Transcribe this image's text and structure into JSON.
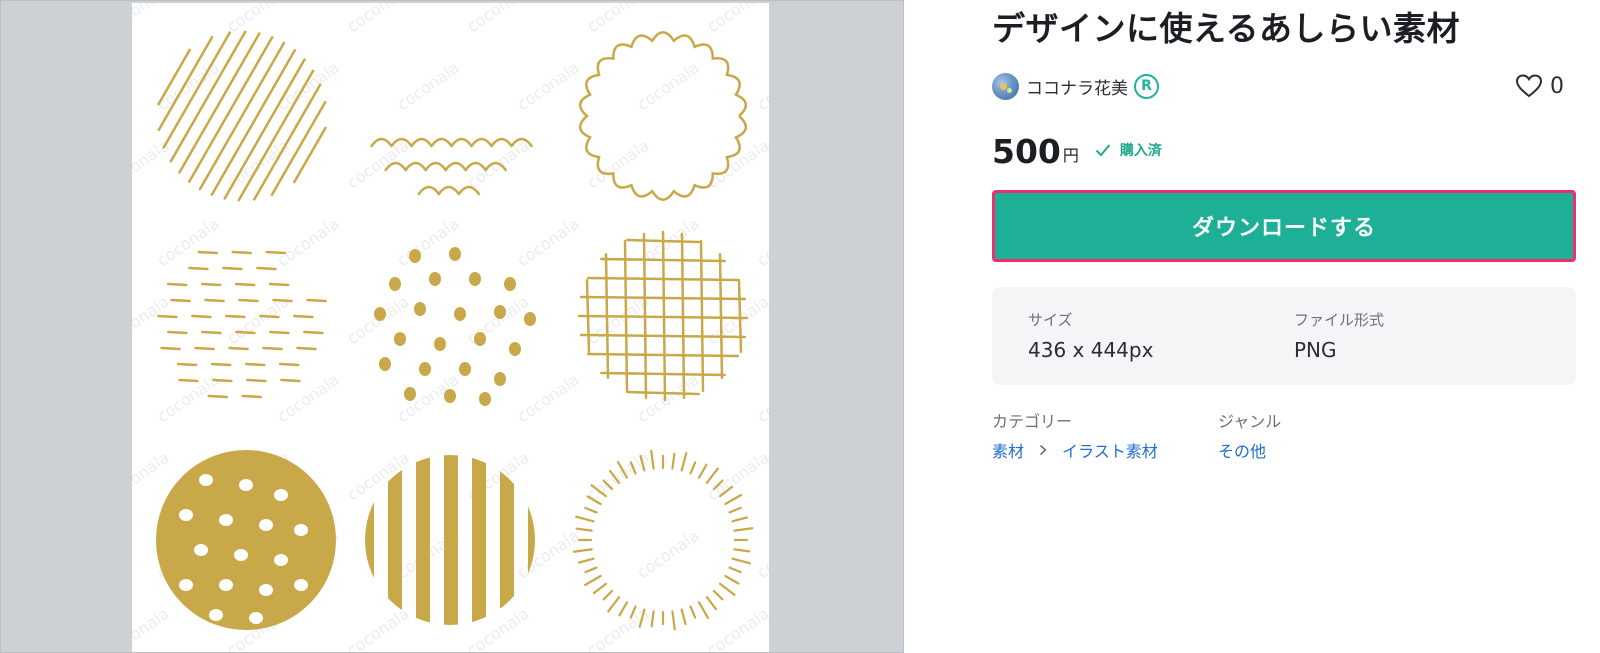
{
  "product": {
    "title": "デザインに使えるあしらい素材",
    "author": "ココナラ花美",
    "rank_badge": "R",
    "favorite_count": "0",
    "price": "500",
    "currency": "円",
    "purchase_status": "購入済",
    "download_label": "ダウンロードする"
  },
  "specs": {
    "size_label": "サイズ",
    "size_value": "436 x 444px",
    "format_label": "ファイル形式",
    "format_value": "PNG"
  },
  "meta": {
    "category_label": "カテゴリー",
    "category_path": [
      "素材",
      "イラスト素材"
    ],
    "genre_label": "ジャンル",
    "genre_value": "その他"
  },
  "preview": {
    "watermark": "coconala",
    "pattern_color": "#c9a84a"
  },
  "icons": {
    "avatar": "user-avatar",
    "heart": "heart-icon",
    "check": "check-icon",
    "chevron": "chevron-right-icon"
  },
  "colors": {
    "primary": "#1db097",
    "highlight_border": "#ee2f6e",
    "link": "#1f6fd1",
    "accent_text": "#22a98d"
  }
}
